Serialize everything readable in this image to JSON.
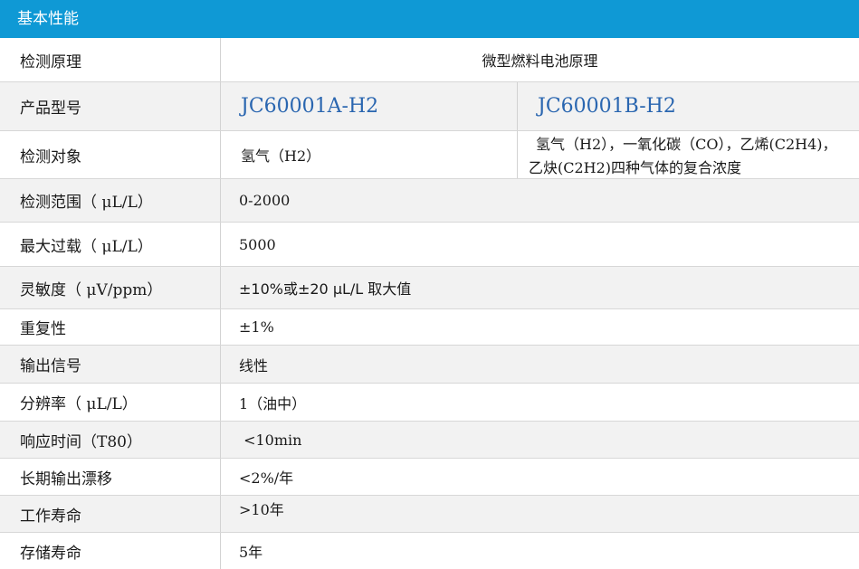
{
  "header": {
    "title": "基本性能"
  },
  "rows": {
    "principle": {
      "label": "检测原理",
      "value": "微型燃料电池原理"
    },
    "model": {
      "label": "产品型号",
      "value_a": "JC60001A-H2",
      "value_b": "JC60001B-H2"
    },
    "target": {
      "label": "检测对象",
      "value_a": "氢气（H2）",
      "value_b_line1": "氢气（H2），一氧化碳（CO），乙烯(C2H4)，",
      "value_b_line2": "乙炔(C2H2)四种气体的复合浓度"
    },
    "range": {
      "label": "检测范围（ μL/L）",
      "value": "0-2000"
    },
    "overload": {
      "label": "最大过载（ μL/L）",
      "value": "5000"
    },
    "sensitivity": {
      "label": "灵敏度（ μV/ppm）",
      "value": "±10%或±20 μL/L 取大值"
    },
    "repeatability": {
      "label": "重复性",
      "value": "±1%"
    },
    "output": {
      "label": "输出信号",
      "value": "线性"
    },
    "resolution": {
      "label": "分辨率（ μL/L）",
      "value": "1（油中）"
    },
    "response": {
      "label": "响应时间（T80）",
      "value": " <10min"
    },
    "drift": {
      "label": "长期输出漂移",
      "value": "<2%/年"
    },
    "life": {
      "label": "工作寿命",
      "value": ">10年"
    },
    "storage": {
      "label": "存储寿命",
      "value": "5年"
    }
  },
  "colors": {
    "header_bg": "#0f99d5",
    "model_text": "#2a66b0",
    "shade_row": "#f2f2f2"
  }
}
